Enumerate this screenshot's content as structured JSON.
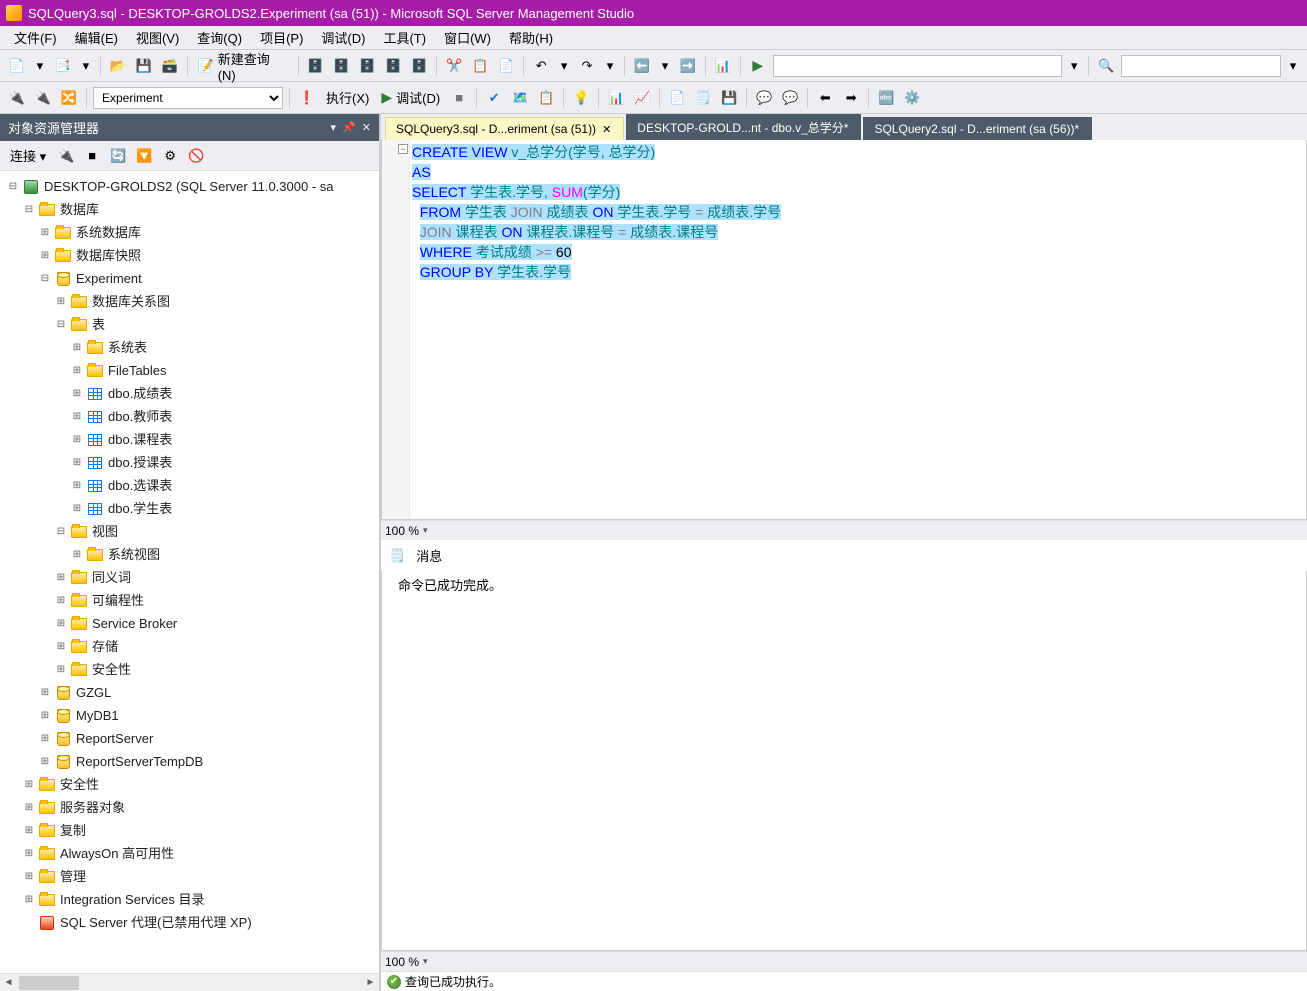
{
  "titlebar": {
    "text": "SQLQuery3.sql - DESKTOP-GROLDS2.Experiment (sa (51)) - Microsoft SQL Server Management Studio"
  },
  "menubar": {
    "items": [
      "文件(F)",
      "编辑(E)",
      "视图(V)",
      "查询(Q)",
      "项目(P)",
      "调试(D)",
      "工具(T)",
      "窗口(W)",
      "帮助(H)"
    ]
  },
  "toolbar1": {
    "new_query": "新建查询(N)",
    "find_input": ""
  },
  "toolbar2": {
    "db_selector": "Experiment",
    "execute": "执行(X)",
    "debug": "调试(D)"
  },
  "object_explorer": {
    "title": "对象资源管理器",
    "connect_label": "连接 ▾",
    "root": "DESKTOP-GROLDS2 (SQL Server 11.0.3000 - sa",
    "nodes": {
      "databases": "数据库",
      "system_dbs": "系统数据库",
      "db_snapshots": "数据库快照",
      "experiment": "Experiment",
      "db_diagrams": "数据库关系图",
      "tables": "表",
      "system_tables": "系统表",
      "filetables": "FileTables",
      "t1": "dbo.成绩表",
      "t2": "dbo.教师表",
      "t3": "dbo.课程表",
      "t4": "dbo.授课表",
      "t5": "dbo.选课表",
      "t6": "dbo.学生表",
      "views": "视图",
      "system_views": "系统视图",
      "synonyms": "同义词",
      "programmability": "可编程性",
      "service_broker": "Service Broker",
      "storage": "存储",
      "security_db": "安全性",
      "gzgl": "GZGL",
      "mydb1": "MyDB1",
      "reportserver": "ReportServer",
      "reportservertempdb": "ReportServerTempDB",
      "srv_security": "安全性",
      "server_objects": "服务器对象",
      "replication": "复制",
      "alwayson": "AlwaysOn 高可用性",
      "management": "管理",
      "integration": "Integration Services 目录",
      "agent": "SQL Server 代理(已禁用代理 XP)"
    }
  },
  "tabs": {
    "t1": "SQLQuery3.sql - D...eriment (sa (51))",
    "t2": "DESKTOP-GROLD...nt - dbo.v_总学分*",
    "t3": "SQLQuery2.sql - D...eriment (sa (56))*"
  },
  "code": {
    "l1": {
      "a": "CREATE",
      "b": "VIEW",
      "c": "v_总学分(学号, 总学分)"
    },
    "l2": {
      "a": "AS"
    },
    "l3": {
      "a": "SELECT",
      "b": " 学生表.学号,",
      "c": "SUM",
      "d": "(学分)"
    },
    "l4": {
      "a": "FROM",
      "b": " 学生表 ",
      "c": "JOIN",
      "d": " 成绩表 ",
      "e": "ON",
      "f": " 学生表.学号 ",
      "g": "=",
      "h": " 成绩表.学号"
    },
    "l5": {
      "a": "JOIN",
      "b": " 课程表 ",
      "c": "ON",
      "d": " 课程表.课程号 ",
      "e": "=",
      "f": " 成绩表.课程号"
    },
    "l6": {
      "a": "WHERE",
      "b": " 考试成绩 ",
      "c": ">=",
      "d": " 60"
    },
    "l7": {
      "a": "GROUP",
      "b": "BY",
      "c": " 学生表.学号"
    }
  },
  "zoom": {
    "value": "100 %"
  },
  "messages": {
    "tab": "消息",
    "body": "命令已成功完成。"
  },
  "statusbar": {
    "text": "查询已成功执行。"
  }
}
